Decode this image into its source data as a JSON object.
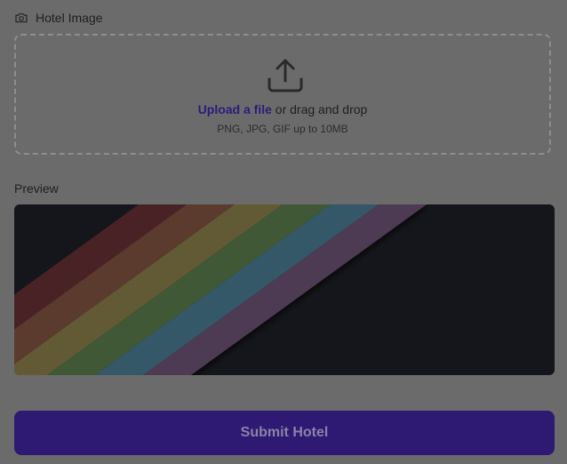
{
  "image_section": {
    "label": "Hotel Image",
    "icon": "camera-icon"
  },
  "dropzone": {
    "icon": "upload-icon",
    "link_text": "Upload a file",
    "rest_text": " or drag and drop",
    "hint": "PNG, JPG, GIF up to 10MB"
  },
  "preview": {
    "label": "Preview",
    "stripe_colors": [
      "#4a2327",
      "#5a3a2d",
      "#625a36",
      "#3f5936",
      "#355868",
      "#4e3a52"
    ],
    "background": "#15161b"
  },
  "submit": {
    "label": "Submit Hotel"
  }
}
